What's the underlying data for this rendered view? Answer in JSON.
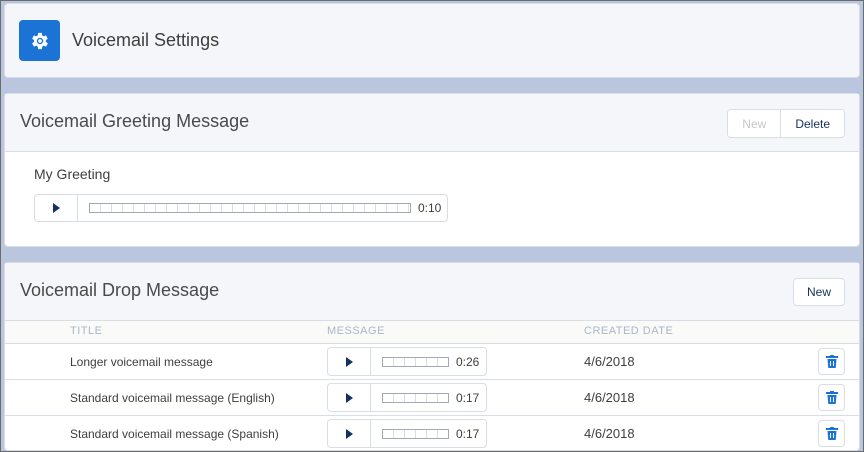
{
  "header": {
    "title": "Voicemail Settings",
    "icon": "gear-icon",
    "icon_color": "#1b74d5"
  },
  "greeting_section": {
    "title": "Voicemail Greeting Message",
    "new_label": "New",
    "delete_label": "Delete",
    "greeting": {
      "name": "My Greeting",
      "duration": "0:10",
      "progress": 0
    }
  },
  "drop_section": {
    "title": "Voicemail Drop Message",
    "new_label": "New",
    "columns": [
      "TITLE",
      "MESSAGE",
      "CREATED DATE"
    ],
    "rows": [
      {
        "title": "Longer voicemail message",
        "duration": "0:26",
        "created": "4/6/2018"
      },
      {
        "title": "Standard voicemail message (English)",
        "duration": "0:17",
        "created": "4/6/2018"
      },
      {
        "title": "Standard voicemail message (Spanish)",
        "duration": "0:17",
        "created": "4/6/2018"
      }
    ]
  },
  "colors": {
    "accent": "#1b74d5",
    "background": "#b9c6de"
  }
}
